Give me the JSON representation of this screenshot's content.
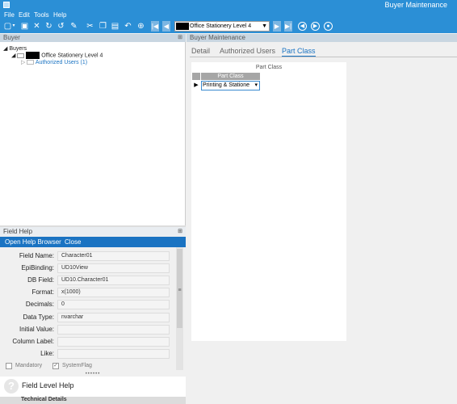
{
  "window": {
    "title": "Buyer Maintenance"
  },
  "menu": [
    "File",
    "Edit",
    "Tools",
    "Help"
  ],
  "toolbar": {
    "icons": [
      "new-icon",
      "save-icon",
      "delete-icon",
      "refresh-icon",
      "undo-icon",
      "clear-icon",
      "cut-icon",
      "copy-icon",
      "paste-icon",
      "undo-arrow-icon",
      "search-binoculars-icon"
    ],
    "nav_first": "|◀",
    "nav_prev": "◀",
    "nav_next": "▶",
    "nav_last": "▶|",
    "record_select": "Office Stationery Level 4",
    "circle_left": "◀",
    "circle_right": "▶",
    "circle_home": "●"
  },
  "left_pane": {
    "header": "Buyer",
    "tree_root": "Buyers",
    "tree_node": "Office Stationery Level 4",
    "tree_child": "Authorized Users (1)"
  },
  "field_help": {
    "header": "Field Help",
    "open_browser": "Open Help Browser",
    "close": "Close",
    "rows": [
      {
        "label": "Field Name:",
        "value": "Character01"
      },
      {
        "label": "EpiBinding:",
        "value": "UD10View"
      },
      {
        "label": "DB Field:",
        "value": "UD10.Character01"
      },
      {
        "label": "Format:",
        "value": "x(1000)"
      },
      {
        "label": "Decimals:",
        "value": "0"
      },
      {
        "label": "Data Type:",
        "value": "nvarchar"
      },
      {
        "label": "Initial Value:",
        "value": ""
      },
      {
        "label": "Column Label:",
        "value": ""
      },
      {
        "label": "Like:",
        "value": ""
      }
    ],
    "mandatory_label": "Mandatory",
    "systemflag_label": "SystemFlag",
    "field_level_help": "Field Level Help",
    "bottom_text": "Technical Details"
  },
  "right_pane": {
    "header": "Buyer Maintenance",
    "tabs": [
      "Detail",
      "Authorized Users",
      "Part Class"
    ],
    "active_tab": "Part Class",
    "grid_caption": "Part Class",
    "grid_column": "Part Class",
    "grid_value": "Printing & Statione"
  },
  "colors": {
    "accent": "#2b8fd6",
    "tab_active": "#1a73c2"
  }
}
